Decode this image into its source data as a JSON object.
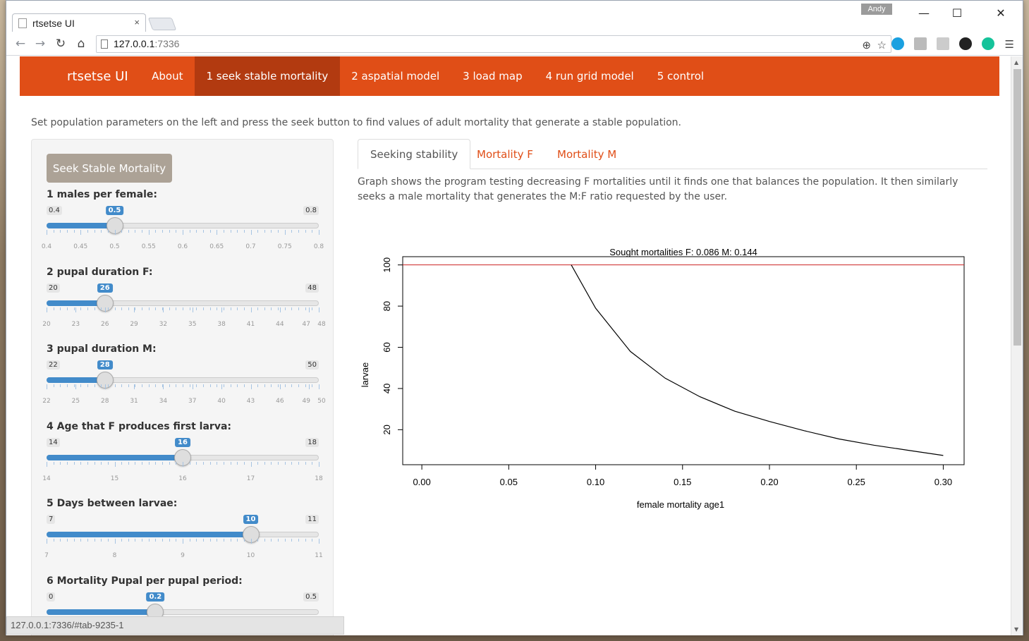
{
  "browser": {
    "tab_title": "rtsetse UI",
    "tab_close": "×",
    "user_badge": "Andy",
    "url_host": "127.0.0.1",
    "url_port": ":7336",
    "status_url": "127.0.0.1:7336/#tab-9235-1"
  },
  "navbar": {
    "brand": "rtsetse UI",
    "items": [
      "About",
      "1 seek stable mortality",
      "2 aspatial model",
      "3 load map",
      "4 run grid model",
      "5 control"
    ],
    "active_index": 1,
    "color": "#e04e17",
    "active_color": "#b23a10"
  },
  "intro": "Set population parameters on the left and press the seek button to find values of adult mortality that generate a stable population.",
  "sidebar": {
    "seek_button": "Seek Stable Mortality",
    "sliders": [
      {
        "label": "1 males per female:",
        "min": 0.4,
        "max": 0.8,
        "value": 0.5,
        "min_label": "0.4",
        "max_label": "0.8",
        "value_label": "0.5",
        "ticks": [
          "0.4",
          "0.45",
          "0.5",
          "0.55",
          "0.6",
          "0.65",
          "0.7",
          "0.75",
          "0.8"
        ],
        "tick_values": [
          0.4,
          0.45,
          0.5,
          0.55,
          0.6,
          0.65,
          0.7,
          0.75,
          0.8
        ]
      },
      {
        "label": "2 pupal duration F:",
        "min": 20,
        "max": 48,
        "value": 26,
        "min_label": "20",
        "max_label": "48",
        "value_label": "26",
        "ticks": [
          "20",
          "23",
          "26",
          "29",
          "32",
          "35",
          "38",
          "41",
          "44",
          "47",
          "48"
        ],
        "tick_values": [
          20,
          23,
          26,
          29,
          32,
          35,
          38,
          41,
          44,
          47,
          48
        ]
      },
      {
        "label": "3 pupal duration M:",
        "min": 22,
        "max": 50,
        "value": 28,
        "min_label": "22",
        "max_label": "50",
        "value_label": "28",
        "ticks": [
          "22",
          "25",
          "28",
          "31",
          "34",
          "37",
          "40",
          "43",
          "46",
          "49",
          "50"
        ],
        "tick_values": [
          22,
          25,
          28,
          31,
          34,
          37,
          40,
          43,
          46,
          49,
          50
        ]
      },
      {
        "label": "4 Age that F produces first larva:",
        "min": 14,
        "max": 18,
        "value": 16,
        "min_label": "14",
        "max_label": "18",
        "value_label": "16",
        "ticks": [
          "14",
          "15",
          "16",
          "17",
          "18"
        ],
        "tick_values": [
          14,
          15,
          16,
          17,
          18
        ]
      },
      {
        "label": "5 Days between larvae:",
        "min": 7,
        "max": 11,
        "value": 10,
        "min_label": "7",
        "max_label": "11",
        "value_label": "10",
        "ticks": [
          "7",
          "8",
          "9",
          "10",
          "11"
        ],
        "tick_values": [
          7,
          8,
          9,
          10,
          11
        ]
      },
      {
        "label": "6 Mortality Pupal per pupal period:",
        "min": 0,
        "max": 0.5,
        "value": 0.2,
        "min_label": "0",
        "max_label": "0.5",
        "value_label": "0.2",
        "ticks": [],
        "tick_values": []
      }
    ]
  },
  "main": {
    "tabs": [
      "Seeking stability",
      "Mortality F",
      "Mortality M"
    ],
    "active_tab": 0,
    "description": "Graph shows the program testing decreasing F mortalities until it finds one that balances the population. It then similarly seeks a male mortality that generates the M:F ratio requested by the user."
  },
  "chart_data": {
    "type": "line",
    "title": "Sought mortalities F: 0.086   M: 0.144",
    "xlabel": "female mortality age1",
    "ylabel": "larvae",
    "xlim": [
      -0.011,
      0.312
    ],
    "ylim": [
      3,
      104
    ],
    "x_ticks": [
      0.0,
      0.05,
      0.1,
      0.15,
      0.2,
      0.25,
      0.3
    ],
    "x_tick_labels": [
      "0.00",
      "0.05",
      "0.10",
      "0.15",
      "0.20",
      "0.25",
      "0.30"
    ],
    "y_ticks": [
      20,
      40,
      60,
      80,
      100
    ],
    "y_tick_labels": [
      "20",
      "40",
      "60",
      "80",
      "100"
    ],
    "hline": {
      "y": 100,
      "color": "#cc2222"
    },
    "series": [
      {
        "color": "#000000",
        "x": [
          0.086,
          0.1,
          0.12,
          0.14,
          0.16,
          0.18,
          0.2,
          0.22,
          0.24,
          0.26,
          0.28,
          0.3
        ],
        "y": [
          100,
          79,
          58,
          45,
          36,
          29,
          24,
          19.5,
          15.5,
          12.5,
          10,
          7.5
        ]
      }
    ]
  }
}
